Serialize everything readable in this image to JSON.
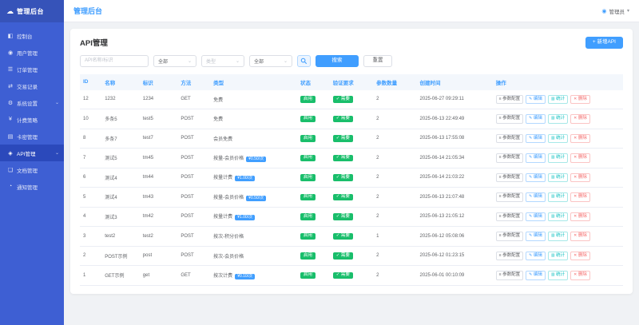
{
  "app": {
    "logo_text": "管理后台",
    "header_title": "管理后台",
    "user": "管理员"
  },
  "sidebar": {
    "items": [
      {
        "label": "控制台",
        "icon": "dashboard-icon",
        "active": false,
        "expandable": false
      },
      {
        "label": "用户管理",
        "icon": "users-icon",
        "active": false,
        "expandable": false
      },
      {
        "label": "订单管理",
        "icon": "orders-icon",
        "active": false,
        "expandable": false
      },
      {
        "label": "交易记录",
        "icon": "transactions-icon",
        "active": false,
        "expandable": false
      },
      {
        "label": "系统设置",
        "icon": "settings-icon",
        "active": false,
        "expandable": true
      },
      {
        "label": "计费策略",
        "icon": "billing-icon",
        "active": false,
        "expandable": false
      },
      {
        "label": "卡密管理",
        "icon": "cards-icon",
        "active": false,
        "expandable": false
      },
      {
        "label": "API管理",
        "icon": "api-icon",
        "active": true,
        "expandable": true
      },
      {
        "label": "文档管理",
        "icon": "docs-icon",
        "active": false,
        "expandable": false
      },
      {
        "label": "通知管理",
        "icon": "notify-icon",
        "active": false,
        "expandable": false
      }
    ]
  },
  "page": {
    "title": "API管理",
    "add_button": "+ 新增API"
  },
  "filters": {
    "keyword_placeholder": "API名称/标识",
    "status_value": "全部",
    "type_value": "类型",
    "scope_value": "全部",
    "search_label": "搜索",
    "reset_label": "重置"
  },
  "table": {
    "headers": [
      "ID",
      "名称",
      "标识",
      "方法",
      "类型",
      "状态",
      "验证要求",
      "参数数量",
      "创建时间",
      "操作"
    ],
    "action_buttons": [
      {
        "label": "参数配置",
        "type": "plain",
        "icon": "params-icon"
      },
      {
        "label": "编辑",
        "type": "primary",
        "icon": "edit-icon"
      },
      {
        "label": "统计",
        "type": "teal",
        "icon": "stats-icon"
      },
      {
        "label": "删除",
        "type": "danger",
        "icon": "delete-icon"
      }
    ],
    "rows": [
      {
        "id": "12",
        "name": "1232",
        "code": "1234",
        "method": "GET",
        "type": "免费",
        "type_badge": "",
        "status": "启用",
        "verify": "需要",
        "params": "2",
        "created": "2025-06-27 09:29:11"
      },
      {
        "id": "10",
        "name": "多条5",
        "code": "test5",
        "method": "POST",
        "type": "免费",
        "type_badge": "",
        "status": "启用",
        "verify": "需要",
        "params": "2",
        "created": "2025-06-13 22:49:49"
      },
      {
        "id": "8",
        "name": "多条7",
        "code": "test7",
        "method": "POST",
        "type": "会员免费",
        "type_badge": "",
        "status": "启用",
        "verify": "需要",
        "params": "2",
        "created": "2025-06-13 17:55:08"
      },
      {
        "id": "7",
        "name": "测试5",
        "code": "tm45",
        "method": "POST",
        "type": "按量-会员价格",
        "type_badge": "¥0.50/次",
        "status": "启用",
        "verify": "需要",
        "params": "2",
        "created": "2025-06-14 21:05:34"
      },
      {
        "id": "6",
        "name": "测试4",
        "code": "tm44",
        "method": "POST",
        "type": "按量计费",
        "type_badge": "¥1.00/次",
        "status": "启用",
        "verify": "需要",
        "params": "2",
        "created": "2025-06-14 21:03:22"
      },
      {
        "id": "5",
        "name": "测试4",
        "code": "tm43",
        "method": "POST",
        "type": "按量-会员价格",
        "type_badge": "¥0.50/次",
        "status": "启用",
        "verify": "需要",
        "params": "2",
        "created": "2025-06-13 21:07:48"
      },
      {
        "id": "4",
        "name": "测试3",
        "code": "tm42",
        "method": "POST",
        "type": "按量计费",
        "type_badge": "¥1.00/次",
        "status": "启用",
        "verify": "需要",
        "params": "2",
        "created": "2025-06-13 21:05:12"
      },
      {
        "id": "3",
        "name": "test2",
        "code": "test2",
        "method": "POST",
        "type": "按次-积分价格",
        "type_badge": "",
        "status": "启用",
        "verify": "需要",
        "params": "1",
        "created": "2025-06-12 05:08:06"
      },
      {
        "id": "2",
        "name": "POST示例",
        "code": "post",
        "method": "POST",
        "type": "按次-会员价格",
        "type_badge": "",
        "status": "启用",
        "verify": "需要",
        "params": "2",
        "created": "2025-06-12 01:23:15"
      },
      {
        "id": "1",
        "name": "GET示例",
        "code": "get",
        "method": "GET",
        "type": "按次计费",
        "type_badge": "¥0.10/次",
        "status": "启用",
        "verify": "需要",
        "params": "2",
        "created": "2025-06-01 00:10:09"
      }
    ]
  },
  "colors": {
    "primary": "#409EFF",
    "sidebar_bg": "#3e5fd3",
    "sidebar_active": "#2b49bb",
    "success": "#19be6b",
    "teal": "#13c2c2",
    "danger": "#f56c6c",
    "header_text": "#409EFF",
    "content_bg": "#f0f2f5"
  }
}
